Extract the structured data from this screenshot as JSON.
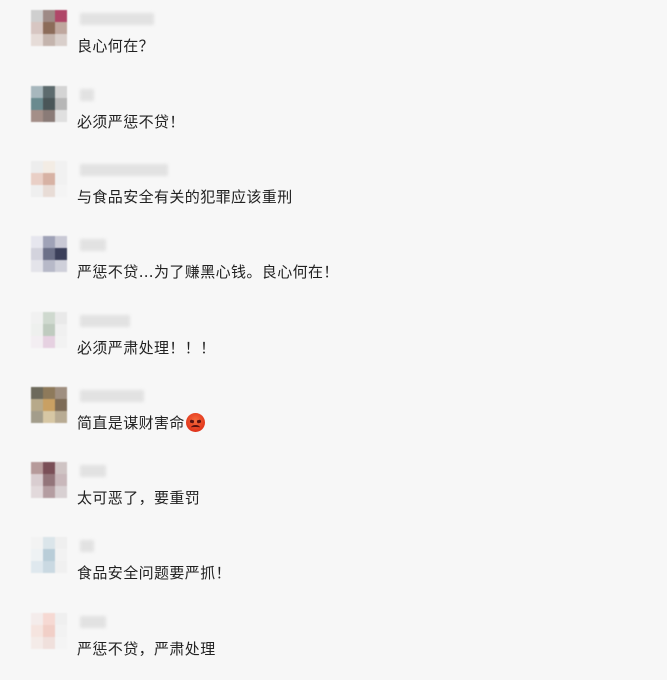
{
  "comments": [
    {
      "text": "良心何在？",
      "avatar_colors": [
        "#cfcfcf",
        "#9e8a86",
        "#b04668",
        "#d7c6c2",
        "#8c6c5a",
        "#bfa79e",
        "#e6dcd8",
        "#c4b4ad",
        "#d9cfcb"
      ]
    },
    {
      "text": "必须严惩不贷！",
      "avatar_colors": [
        "#a7b7bd",
        "#5d6b6e",
        "#d4d4d4",
        "#6a8a8f",
        "#4a5658",
        "#b7b7b7",
        "#a48f88",
        "#8a7b77",
        "#e0e0e0"
      ]
    },
    {
      "text": "与食品安全有关的犯罪应该重刑",
      "avatar_colors": [
        "#ededed",
        "#f3ece4",
        "#f1f1f1",
        "#e9cfc6",
        "#d7b2a4",
        "#f1f1f1",
        "#efefef",
        "#e8dcd6",
        "#f4f4f4"
      ]
    },
    {
      "text": "严惩不贷…为了赚黑心钱。良心何在！",
      "avatar_colors": [
        "#e6e6ee",
        "#9fa2b7",
        "#c9c9d5",
        "#d3d3dd",
        "#6c7088",
        "#3b3f5a",
        "#e4e4ea",
        "#b7b9c8",
        "#cfd0da"
      ]
    },
    {
      "text": "必须严肃处理！！！",
      "avatar_colors": [
        "#f1f1f1",
        "#cfd9cf",
        "#e9e9e9",
        "#eef0ee",
        "#bfcbbf",
        "#f0f0f0",
        "#f3eef2",
        "#e6d1e1",
        "#f2f2f2"
      ]
    },
    {
      "text": "简直是谋财害命",
      "avatar_colors": [
        "#6d6a5c",
        "#8e7a5b",
        "#9f8f80",
        "#b7a98a",
        "#c9a063",
        "#7d6b56",
        "#a39d8b",
        "#d7c7a4",
        "#b8ab93"
      ]
    },
    {
      "text": "太可恶了，要重罚",
      "avatar_colors": [
        "#b69a9a",
        "#7a4f57",
        "#cfc4c4",
        "#d9cdd0",
        "#93757a",
        "#c9b8bb",
        "#e2d9db",
        "#b49da1",
        "#d8d0d2"
      ]
    },
    {
      "text": "食品安全问题要严抓！",
      "avatar_colors": [
        "#f3f3f3",
        "#dbe5ea",
        "#efefef",
        "#eef2f4",
        "#b9cdd8",
        "#f2f2f2",
        "#dfe8ee",
        "#cad9e2",
        "#f0f0f0"
      ]
    },
    {
      "text": "严惩不贷，严肃处理",
      "avatar_colors": [
        "#f4eceb",
        "#f6d9d3",
        "#efefef",
        "#f5e4df",
        "#f1cfc7",
        "#f2f2f2",
        "#f4ebe8",
        "#f0e0dc",
        "#f4f4f4"
      ]
    }
  ],
  "emoji_icon": "angry-face-emoji"
}
